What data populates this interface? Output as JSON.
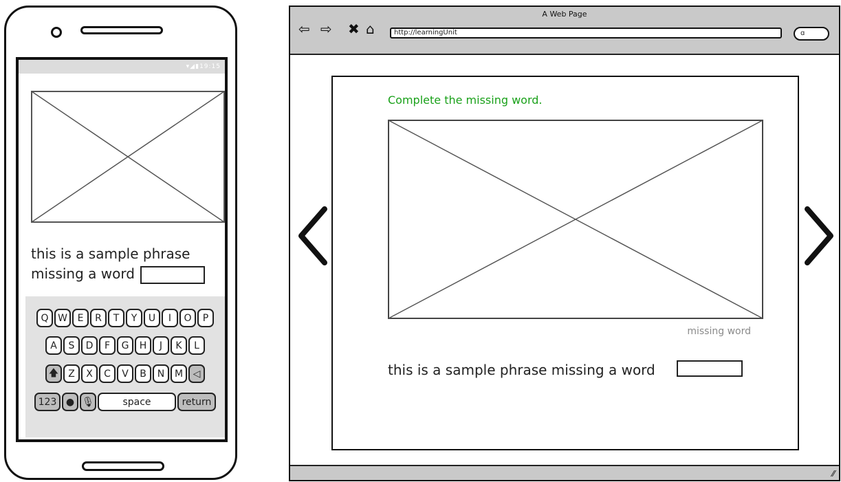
{
  "mobile": {
    "status_text": "19:15",
    "phrase_line1": "this is a sample phrase",
    "phrase_line2": "missing a word",
    "keyboard": {
      "row1": [
        "Q",
        "W",
        "E",
        "R",
        "T",
        "Y",
        "U",
        "I",
        "O",
        "P"
      ],
      "row2": [
        "A",
        "S",
        "D",
        "F",
        "G",
        "H",
        "J",
        "K",
        "L"
      ],
      "row3": [
        "Z",
        "X",
        "C",
        "V",
        "B",
        "N",
        "M"
      ],
      "numbers_label": "123",
      "space_label": "space",
      "return_label": "return"
    }
  },
  "browser": {
    "window_title": "A Web Page",
    "url": "http://learningUnit",
    "instruction": "Complete the missing word.",
    "caption": "missing word",
    "phrase": "this is a sample phrase missing a word"
  },
  "icons": {
    "back": "back-arrow-icon",
    "forward": "forward-arrow-icon",
    "close": "close-icon",
    "home": "home-icon",
    "search": "search-icon",
    "prev": "chevron-left-icon",
    "next": "chevron-right-icon",
    "resize": "resize-grip-icon"
  },
  "colors": {
    "instruction": "#1aa11a",
    "caption": "#8a8a8a",
    "chrome": "#c9c9c9"
  }
}
